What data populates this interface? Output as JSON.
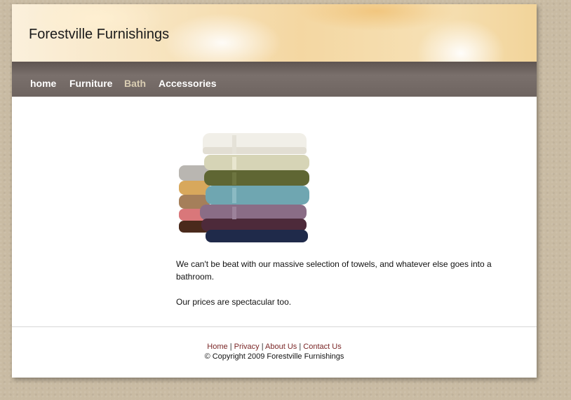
{
  "header": {
    "site_title": "Forestville Furnishings"
  },
  "nav": {
    "items": [
      {
        "label": "home"
      },
      {
        "label": "Furniture"
      },
      {
        "label": "Bath"
      },
      {
        "label": "Accessories"
      }
    ],
    "active_index": 2
  },
  "main": {
    "image": {
      "subject": "stack of folded towels",
      "icon_name": "towels-image"
    },
    "paragraph1": "We can't be beat with our massive selection of towels, and whatever else goes into a bathroom.",
    "paragraph2": "Our prices are spectacular too."
  },
  "footer": {
    "links": [
      {
        "label": "Home"
      },
      {
        "label": "Privacy"
      },
      {
        "label": "About Us"
      },
      {
        "label": "Contact Us"
      }
    ],
    "separator": "|",
    "copyright": "© Copyright 2009 Forestville Furnishings"
  },
  "colors": {
    "background": "#c9bba3",
    "nav_bar": "#6e6460",
    "nav_active": "#d9cdb2",
    "footer_link": "#7a2626"
  }
}
